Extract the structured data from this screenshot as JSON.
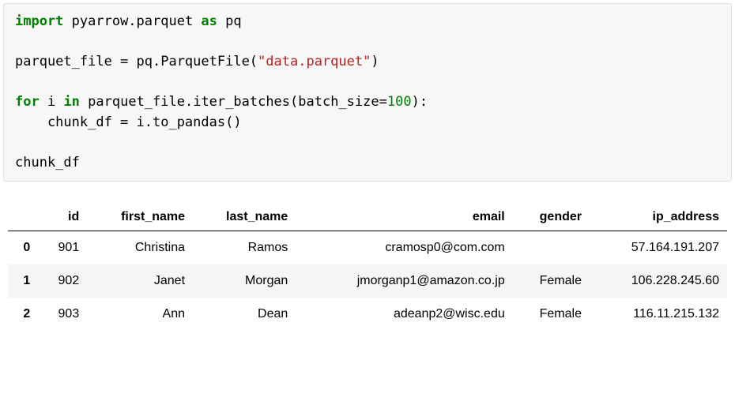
{
  "code": {
    "line1": {
      "kw_import": "import",
      "mod": " pyarrow.parquet ",
      "kw_as": "as",
      "alias": " pq"
    },
    "line2": "",
    "line3": {
      "pre": "parquet_file = pq.ParquetFile(",
      "str": "\"data.parquet\"",
      "post": ")"
    },
    "line4": "",
    "line5": {
      "kw_for": "for",
      "mid1": " i ",
      "kw_in": "in",
      "mid2": " parquet_file.iter_batches(batch_size=",
      "num": "100",
      "post": "):"
    },
    "line6": "    chunk_df = i.to_pandas()",
    "line7": "",
    "line8": "chunk_df"
  },
  "chart_data": {
    "type": "table",
    "columns": [
      "id",
      "first_name",
      "last_name",
      "email",
      "gender",
      "ip_address"
    ],
    "index": [
      "0",
      "1",
      "2"
    ],
    "rows": [
      {
        "id": "901",
        "first_name": "Christina",
        "last_name": "Ramos",
        "email": "cramosp0@com.com",
        "gender": "",
        "ip_address": "57.164.191.207"
      },
      {
        "id": "902",
        "first_name": "Janet",
        "last_name": "Morgan",
        "email": "jmorganp1@amazon.co.jp",
        "gender": "Female",
        "ip_address": "106.228.245.60"
      },
      {
        "id": "903",
        "first_name": "Ann",
        "last_name": "Dean",
        "email": "adeanp2@wisc.edu",
        "gender": "Female",
        "ip_address": "116.11.215.132"
      }
    ]
  }
}
